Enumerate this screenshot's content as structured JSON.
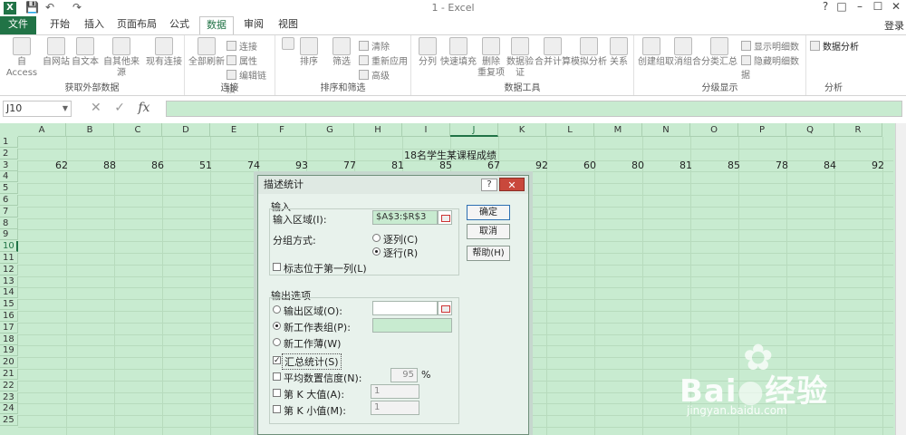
{
  "window": {
    "title": "1 - Excel",
    "login": "登录"
  },
  "tabs": [
    "文件",
    "开始",
    "插入",
    "页面布局",
    "公式",
    "数据",
    "审阅",
    "视图"
  ],
  "ribbon": {
    "get_external": {
      "label": "获取外部数据",
      "buttons": [
        "自 Access",
        "自网站",
        "自文本",
        "自其他来源",
        "现有连接"
      ]
    },
    "connections": {
      "label": "连接",
      "refresh": "全部刷新",
      "small": [
        "连接",
        "属性",
        "编辑链接"
      ]
    },
    "sort_filter": {
      "label": "排序和筛选",
      "sort": "排序",
      "filter": "筛选",
      "small": [
        "清除",
        "重新应用",
        "高级"
      ]
    },
    "data_tools": {
      "label": "数据工具",
      "buttons": [
        "分列",
        "快速填充",
        "删除\n重复项",
        "数据验\n证",
        "合并计算",
        "模拟分析",
        "关系"
      ]
    },
    "outline": {
      "label": "分级显示",
      "buttons": [
        "创建组",
        "取消组合",
        "分类汇总"
      ],
      "small": [
        "显示明细数据",
        "隐藏明细数据"
      ]
    },
    "analysis": {
      "label": "分析",
      "button": "数据分析"
    }
  },
  "formula_bar": {
    "namebox": "J10",
    "fx": "fx"
  },
  "sheet": {
    "columns": [
      "A",
      "B",
      "C",
      "D",
      "E",
      "F",
      "G",
      "H",
      "I",
      "J",
      "K",
      "L",
      "M",
      "N",
      "O",
      "P",
      "Q",
      "R"
    ],
    "rows": [
      "1",
      "2",
      "3",
      "4",
      "5",
      "6",
      "7",
      "8",
      "9",
      "10",
      "11",
      "12",
      "13",
      "14",
      "15",
      "16",
      "17",
      "18",
      "19",
      "20",
      "21",
      "22",
      "23",
      "24",
      "25"
    ],
    "title_cell": "18名学生某课程成绩",
    "scores": [
      "62",
      "88",
      "86",
      "51",
      "74",
      "93",
      "77",
      "81",
      "85",
      "67",
      "92",
      "60",
      "80",
      "81",
      "85",
      "78",
      "84",
      "92"
    ]
  },
  "dialog": {
    "title": "描述统计",
    "help": "?",
    "close": "✕",
    "input_section": "输入",
    "input_range_label": "输入区域(I):",
    "input_range_value": "$A$3:$R$3",
    "group_by_label": "分组方式:",
    "by_column": "逐列(C)",
    "by_row": "逐行(R)",
    "labels_first_col": "标志位于第一列(L)",
    "output_section": "输出选项",
    "output_range": "输出区域(O):",
    "new_sheet": "新工作表组(P):",
    "new_workbook": "新工作薄(W)",
    "summary_stats": "汇总统计(S)",
    "confidence": "平均数置信度(N):",
    "confidence_value": "95",
    "percent": "%",
    "kth_largest": "第 K 大值(A):",
    "kth_largest_value": "1",
    "kth_smallest": "第 K 小值(M):",
    "kth_smallest_value": "1",
    "ok": "确定",
    "cancel": "取消",
    "helpbtn": "帮助(H)"
  },
  "watermark": {
    "brand": "Bai",
    "brand2": "经验",
    "url": "jingyan.baidu.com"
  },
  "icons": [
    "excel-logo-icon",
    "save-icon",
    "undo-icon",
    "redo-icon",
    "paw-icon",
    "fx-icon"
  ],
  "colors": {
    "excel_green": "#217346",
    "grid_bg": "#c8ebd0"
  }
}
